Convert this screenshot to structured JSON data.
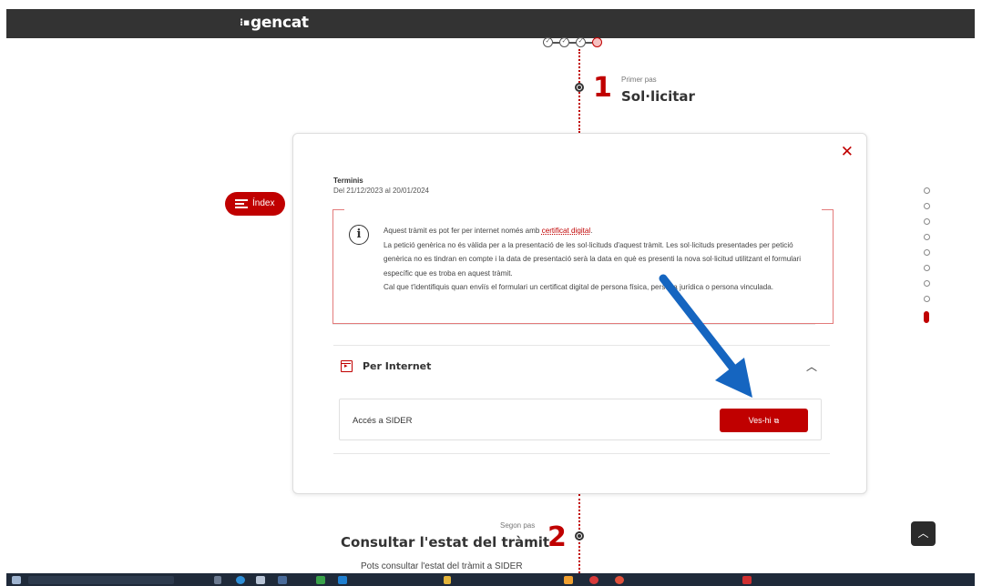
{
  "header": {
    "logo_text": "gencat",
    "logo_mark": "⁝▪"
  },
  "progress": {
    "done_mark": "✓",
    "steps_total": 4,
    "current_step": 4
  },
  "steps": [
    {
      "number": "1",
      "kicker": "Primer pas",
      "title": "Sol·licitar"
    },
    {
      "number": "2",
      "kicker": "Segon pas",
      "title": "Consultar l'estat del tràmit",
      "description": "Pots consultar l'estat del tràmit a SIDER"
    }
  ],
  "index_button": {
    "label": "Índex"
  },
  "card": {
    "close_symbol": "✕",
    "deadline_label": "Terminis",
    "deadline_value": "Del 21/12/2023 al 20/01/2024",
    "alert": {
      "icon_symbol": "i",
      "line1_before": "Aquest tràmit es pot fer per internet només amb ",
      "line1_link": "certificat digital",
      "line1_after": ".",
      "line2": "La petició genèrica no és vàlida per a la presentació de les sol·licituds d'aquest tràmit. Les sol·licituds presentades per petició genèrica no es tindran en compte i la data de presentació serà la data en què es presenti la nova sol·licitud utilitzant el formulari específic que es troba en aquest tràmit.",
      "line3": "Cal que t'identifiquis quan enviïs el formulari un certificat digital de persona física, persona jurídica o persona vinculada."
    },
    "accordion": {
      "title": "Per Internet",
      "chevron": "︿",
      "access_label": "Accés a SIDER",
      "button_label": "Ves-hi",
      "button_icon": "⧉"
    }
  },
  "side_nav": {
    "dot_count": 9,
    "current_index": 9
  },
  "scroll_top": {
    "symbol": "︿"
  },
  "colors": {
    "accent": "#c00000",
    "header_bg": "#333333",
    "annotation_arrow": "#1565c0"
  }
}
